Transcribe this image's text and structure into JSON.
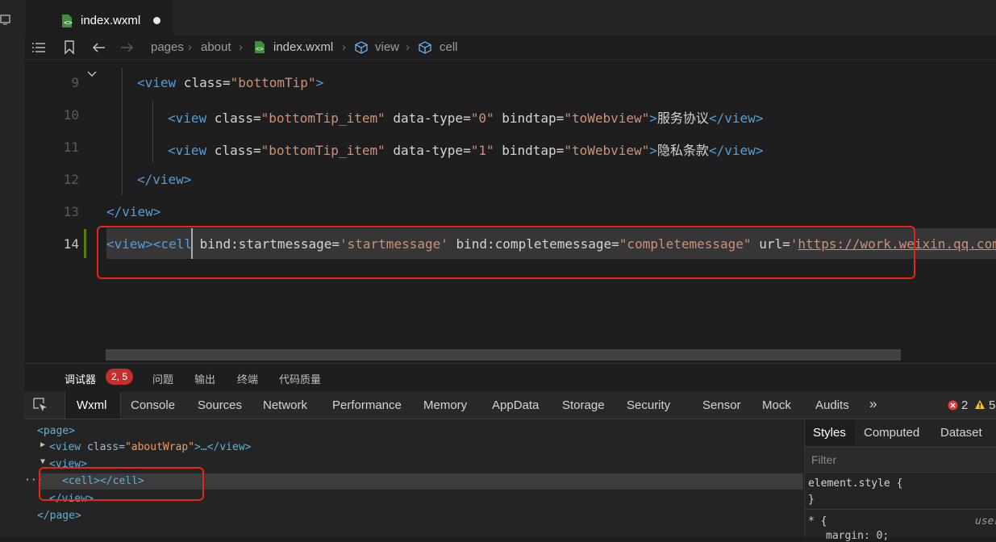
{
  "tab": {
    "filename": "index.wxml"
  },
  "breadcrumb": [
    "pages",
    "about",
    "index.wxml",
    "view",
    "cell"
  ],
  "editor": {
    "line_numbers": [
      "9",
      "10",
      "11",
      "12",
      "13",
      "14"
    ],
    "line9": {
      "open": "<view",
      "attr": " class=",
      "val": "\"bottomTip\"",
      "close": ">"
    },
    "line10": {
      "open": "<view",
      "a1": " class=",
      "v1": "\"bottomTip_item\"",
      "a2": " data-type=",
      "v2": "\"0\"",
      "a3": " bindtap=",
      "v3": "\"toWebview\"",
      "gt": ">",
      "text": "服务协议",
      "end": "</view>"
    },
    "line11": {
      "open": "<view",
      "a1": " class=",
      "v1": "\"bottomTip_item\"",
      "a2": " data-type=",
      "v2": "\"1\"",
      "a3": " bindtap=",
      "v3": "\"toWebview\"",
      "gt": ">",
      "text": "隐私条款",
      "end": "</view>"
    },
    "line12": "</view>",
    "line13": "</view>",
    "line14": {
      "t1": "<view>",
      "t2": "<cell",
      "a1": " bind:startmessage=",
      "q1": "'",
      "v1": "startmessage",
      "q2": "'",
      "a2": " bind:completemessage=",
      "v2": "\"completemessage\"",
      "a3": " url=",
      "q3": "'",
      "url": "https://work.weixin.qq.com"
    }
  },
  "devtools": {
    "panel_tabs": [
      "调试器",
      "问题",
      "输出",
      "终端",
      "代码质量"
    ],
    "badge": "2, 5",
    "tabs": [
      "Wxml",
      "Console",
      "Sources",
      "Network",
      "Performance",
      "Memory",
      "AppData",
      "Storage",
      "Security",
      "Sensor",
      "Mock",
      "Audits"
    ],
    "more": "»",
    "errors": "2",
    "warnings": "5",
    "tree": {
      "page_open": "<page>",
      "row2_tag": "<view",
      "row2_attr": " class=",
      "row2_val": "\"aboutWrap\"",
      "row2_rest": ">…</view>",
      "row3": "<view>",
      "row4": "<cell></cell>",
      "row5": "</view>",
      "page_close": "</page>"
    },
    "styles": {
      "tabs": [
        "Styles",
        "Computed",
        "Dataset"
      ],
      "filter_placeholder": "Filter",
      "element_style": "element.style {",
      "close_brace": "}",
      "rule_selector": "* {",
      "user_agent": "user",
      "prop": "margin: 0;"
    }
  }
}
